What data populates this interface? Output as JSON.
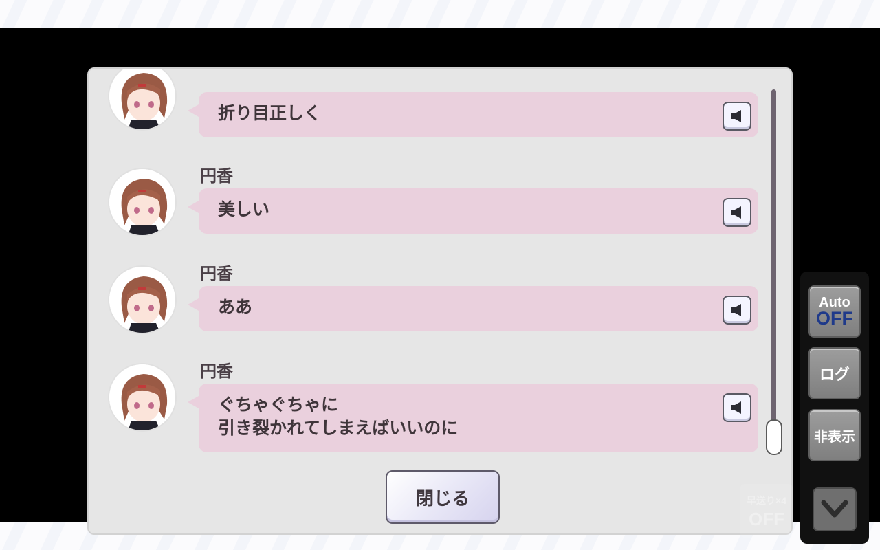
{
  "log": {
    "entries": [
      {
        "speaker": "",
        "text": "折り目正しく"
      },
      {
        "speaker": "円香",
        "text": "美しい"
      },
      {
        "speaker": "円香",
        "text": "ああ"
      },
      {
        "speaker": "円香",
        "text": "ぐちゃぐちゃに\n引き裂かれてしまえばいいのに"
      }
    ],
    "voice_icon": "speaker-icon",
    "close_label": "閉じる"
  },
  "controls": {
    "auto_label": "Auto",
    "auto_state": "OFF",
    "log_label": "ログ",
    "hide_label": "非表示",
    "fast_forward_label": "早送り×4",
    "fast_forward_state": "OFF",
    "down_icon": "chevron-down-icon"
  },
  "colors": {
    "bubble": "#ead0dd",
    "panel": "#e6e6e6",
    "auto_off": "#1f3a8a"
  }
}
